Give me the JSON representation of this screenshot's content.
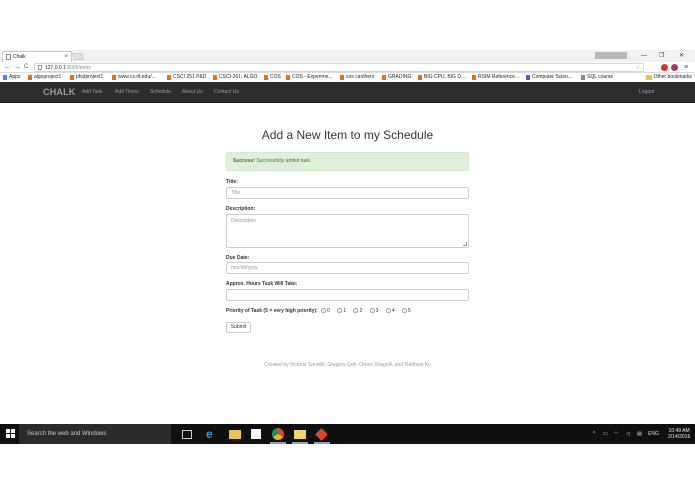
{
  "browser": {
    "tab_title": "Chalk",
    "tab_close": "×",
    "profile_label": "",
    "window_controls": [
      "—",
      "❐",
      "✕"
    ],
    "nav": {
      "back": "←",
      "forward": "→",
      "reload": "C"
    },
    "url_host": "127.0.0.1",
    "url_path": ":8000/entry",
    "star": "☆",
    "menu": "≡",
    "bookmarks": [
      {
        "label": "Apps",
        "color": "#4285f4"
      },
      {
        "label": "algoproject1",
        "color": "#e8710a"
      },
      {
        "label": "pfsdproject1",
        "color": "#e8710a"
      },
      {
        "label": "www.cs.rit.edu/...",
        "color": "#e8710a"
      },
      {
        "label": "CSCI 251 P&D",
        "color": "#e8710a"
      },
      {
        "label": "CSCI-261: ALGO",
        "color": "#e8710a"
      },
      {
        "label": "COS",
        "color": "#e8710a"
      },
      {
        "label": "COS - Experime...",
        "color": "#e8710a"
      },
      {
        "label": "cos canthers",
        "color": "#e8710a"
      },
      {
        "label": "GRADING",
        "color": "#e8710a"
      },
      {
        "label": "BIG CPU, BIG D...",
        "color": "#e8710a"
      },
      {
        "label": "RSIM Reference...",
        "color": "#e8710a"
      },
      {
        "label": "Computer Scien...",
        "color": "#3b6fb6"
      },
      {
        "label": "SQL course",
        "color": "#888888"
      }
    ],
    "other_bookmarks": "Other bookmarks"
  },
  "app": {
    "brand": "CHALK",
    "nav_items": [
      "Add Task",
      "Add Times",
      "Schedule",
      "About Us",
      "Contact Us"
    ],
    "logout": "Logout",
    "heading": "Add a New Item to my Schedule",
    "alert": {
      "strong": "Success!",
      "text": " Successfully added task."
    },
    "form": {
      "title_label": "Title:",
      "title_placeholder": "Title",
      "description_label": "Description:",
      "description_placeholder": "Description",
      "due_label": "Due Date:",
      "due_placeholder": "mm/dd/yyyy",
      "hours_label": "Approx. Hours Task Will Take:",
      "hours_value": "",
      "priority_label": "Priority of Task (5 = very high priority):",
      "priority_options": [
        "0",
        "1",
        "2",
        "3",
        "4",
        "5"
      ],
      "submit": "Submit"
    },
    "footer": "Created by Victoria Sardelli, Gregory Goh, Orens Xhagolli, and Matthew Ku"
  },
  "taskbar": {
    "search_placeholder": "Search the web and Windows",
    "tray_lang": "ENG",
    "time": "10:49 AM",
    "date": "2/14/2016"
  },
  "colors": {
    "navbar": "#2d2d2d",
    "alert_bg": "#dff0d8",
    "alert_text": "#3c763d",
    "taskbar": "#101010"
  }
}
